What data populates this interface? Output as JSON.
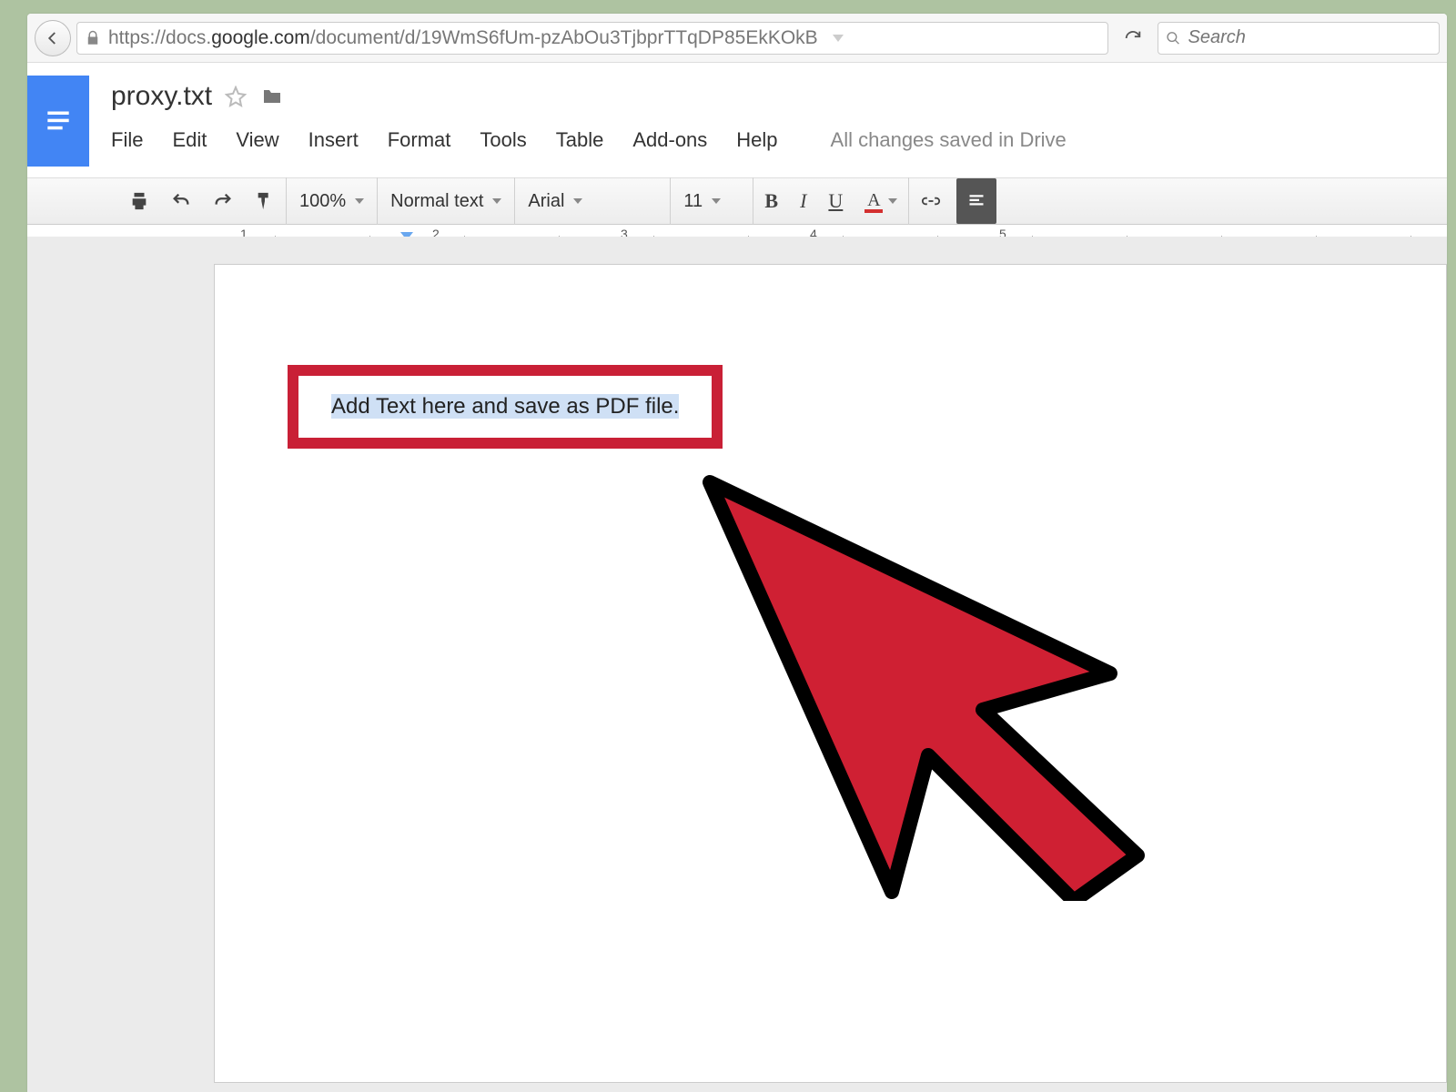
{
  "browser": {
    "url_pre": "https://docs.",
    "url_host": "google.com",
    "url_path": "/document/d/19WmS6fUm-pzAbOu3TjbprTTqDP85EkKOkB",
    "search_placeholder": "Search"
  },
  "docs": {
    "title": "proxy.txt",
    "menu": [
      "File",
      "Edit",
      "View",
      "Insert",
      "Format",
      "Tools",
      "Table",
      "Add-ons",
      "Help"
    ],
    "save_status": "All changes saved in Drive"
  },
  "toolbar": {
    "zoom": "100%",
    "style": "Normal text",
    "font": "Arial",
    "font_size": "11",
    "bold": "B",
    "italic": "I",
    "underline": "U",
    "text_color": "A"
  },
  "ruler": {
    "numbers": [
      "1",
      "2",
      "3",
      "4",
      "5"
    ]
  },
  "document": {
    "body_text": "Add Text here and save as PDF file."
  }
}
